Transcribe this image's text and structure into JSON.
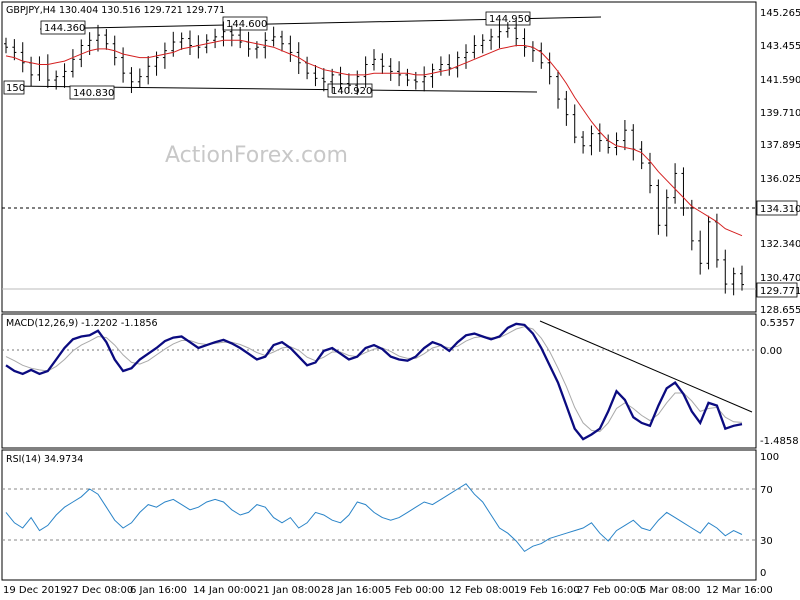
{
  "chart_data": [
    {
      "type": "candlestick",
      "header": "GBPJPY,H4  130.404 130.516 129.721 129.771",
      "watermark": "ActionForex.com",
      "ylim": [
        128.3,
        146.0
      ],
      "y_ticks": [
        "145.265",
        "143.455",
        "141.590",
        "139.710",
        "137.895",
        "136.025",
        "134.310",
        "132.340",
        "130.470",
        "129.771",
        "128.655"
      ],
      "price_labels": {
        "resistance": "134.310",
        "current": "129.771"
      },
      "annotations": [
        "144.360",
        "144.600",
        "144.950",
        "140.830",
        "140.920",
        "150"
      ],
      "x_labels": [
        "19 Dec 2019",
        "27 Dec 08:00",
        "6 Jan 16:00",
        "14 Jan 00:00",
        "21 Jan 08:00",
        "28 Jan 16:00",
        "5 Feb 00:00",
        "12 Feb 08:00",
        "19 Feb 16:00",
        "27 Feb 00:00",
        "5 Mar 08:00",
        "12 Mar 16:00"
      ],
      "closes": [
        143.5,
        143.2,
        142.6,
        141.9,
        142.5,
        141.6,
        141.8,
        142.1,
        142.8,
        143.6,
        143.9,
        144.2,
        143.7,
        142.9,
        142.0,
        141.5,
        141.8,
        142.4,
        142.9,
        143.3,
        143.8,
        144.0,
        143.6,
        143.5,
        143.9,
        144.1,
        144.4,
        144.2,
        143.8,
        143.4,
        143.5,
        143.9,
        144.1,
        143.7,
        143.2,
        142.6,
        142.0,
        141.7,
        141.5,
        141.9,
        141.4,
        141.3,
        141.8,
        142.5,
        142.8,
        142.4,
        142.1,
        141.9,
        141.6,
        141.5,
        141.8,
        142.2,
        142.5,
        142.3,
        142.9,
        143.2,
        143.6,
        143.9,
        144.1,
        144.4,
        144.6,
        144.0,
        143.5,
        143.3,
        142.6,
        141.8,
        140.5,
        139.6,
        138.3,
        137.8,
        138.5,
        138.1,
        137.7,
        138.1,
        138.7,
        137.6,
        136.8,
        135.5,
        133.2,
        134.8,
        136.2,
        134.2,
        132.3,
        131.0,
        133.4,
        131.2,
        129.8,
        130.4,
        129.77
      ],
      "ma": [
        143.0,
        142.9,
        142.7,
        142.6,
        142.5,
        142.5,
        142.6,
        142.7,
        142.9,
        143.1,
        143.3,
        143.4,
        143.4,
        143.3,
        143.1,
        143.0,
        142.9,
        142.9,
        143.0,
        143.1,
        143.2,
        143.4,
        143.5,
        143.6,
        143.7,
        143.8,
        143.9,
        143.9,
        143.9,
        143.8,
        143.7,
        143.6,
        143.5,
        143.3,
        143.1,
        142.9,
        142.6,
        142.4,
        142.2,
        142.1,
        142.0,
        141.9,
        141.9,
        141.9,
        142.0,
        142.0,
        142.0,
        142.0,
        142.0,
        141.9,
        141.9,
        142.0,
        142.1,
        142.2,
        142.4,
        142.6,
        142.8,
        143.0,
        143.2,
        143.4,
        143.5,
        143.6,
        143.6,
        143.5,
        143.2,
        142.7,
        142.1,
        141.4,
        140.6,
        139.9,
        139.2,
        138.6,
        138.1,
        137.8,
        137.7,
        137.6,
        137.4,
        136.9,
        136.3,
        135.8,
        135.3,
        134.8,
        134.3,
        134.0,
        133.7,
        133.4,
        133.0,
        132.8,
        132.6
      ]
    },
    {
      "type": "line",
      "title": "MACD(12,26,9) -1.2202 -1.1856",
      "ylim": [
        -1.6,
        0.62
      ],
      "y_ticks": [
        "0.5357",
        "0.00",
        "-1.4858"
      ],
      "series": [
        {
          "values": [
            -0.2,
            -0.3,
            -0.35,
            -0.28,
            -0.35,
            -0.3,
            -0.1,
            0.1,
            0.25,
            0.3,
            0.32,
            0.4,
            0.2,
            -0.1,
            -0.3,
            -0.25,
            -0.1,
            0.0,
            0.1,
            0.22,
            0.28,
            0.3,
            0.2,
            0.1,
            0.15,
            0.2,
            0.24,
            0.18,
            0.1,
            0.0,
            -0.1,
            -0.05,
            0.15,
            0.2,
            0.1,
            -0.05,
            -0.2,
            -0.15,
            0.05,
            0.1,
            0.0,
            -0.1,
            -0.05,
            0.1,
            0.15,
            0.08,
            -0.05,
            -0.1,
            -0.12,
            -0.05,
            0.1,
            0.2,
            0.15,
            0.05,
            0.2,
            0.32,
            0.35,
            0.3,
            0.25,
            0.3,
            0.45,
            0.52,
            0.5,
            0.35,
            0.1,
            -0.2,
            -0.5,
            -0.9,
            -1.3,
            -1.48,
            -1.4,
            -1.3,
            -1.0,
            -0.65,
            -0.8,
            -1.1,
            -1.2,
            -1.25,
            -0.9,
            -0.6,
            -0.5,
            -0.7,
            -1.0,
            -1.2,
            -0.85,
            -0.9,
            -1.3,
            -1.25,
            -1.22
          ]
        },
        {
          "values": [
            -0.05,
            -0.12,
            -0.2,
            -0.25,
            -0.28,
            -0.3,
            -0.22,
            -0.1,
            0.05,
            0.15,
            0.22,
            0.3,
            0.28,
            0.15,
            -0.02,
            -0.15,
            -0.18,
            -0.12,
            -0.02,
            0.08,
            0.17,
            0.23,
            0.23,
            0.18,
            0.16,
            0.18,
            0.2,
            0.2,
            0.16,
            0.1,
            0.02,
            -0.03,
            0.03,
            0.1,
            0.12,
            0.06,
            -0.06,
            -0.12,
            -0.06,
            0.03,
            0.03,
            -0.03,
            -0.05,
            0.02,
            0.08,
            0.1,
            0.04,
            -0.04,
            -0.08,
            -0.08,
            0.0,
            0.1,
            0.14,
            0.1,
            0.13,
            0.22,
            0.28,
            0.3,
            0.28,
            0.28,
            0.35,
            0.43,
            0.47,
            0.43,
            0.27,
            0.04,
            -0.25,
            -0.57,
            -0.93,
            -1.2,
            -1.33,
            -1.35,
            -1.2,
            -0.95,
            -0.85,
            -0.95,
            -1.07,
            -1.16,
            -1.05,
            -0.85,
            -0.68,
            -0.68,
            -0.82,
            -1.0,
            -0.95,
            -0.93,
            -1.1,
            -1.18,
            -1.19
          ]
        }
      ],
      "trendline": true
    },
    {
      "type": "line",
      "title": "RSI(14) 34.9734",
      "ylim": [
        0,
        100
      ],
      "y_ticks": [
        "100",
        "70",
        "30",
        "0"
      ],
      "levels": [
        70,
        30
      ],
      "series": [
        {
          "values": [
            52,
            44,
            40,
            48,
            38,
            42,
            50,
            56,
            60,
            64,
            70,
            66,
            56,
            46,
            40,
            44,
            52,
            58,
            56,
            60,
            62,
            58,
            54,
            56,
            60,
            62,
            60,
            54,
            50,
            52,
            58,
            56,
            48,
            44,
            48,
            40,
            44,
            52,
            50,
            46,
            44,
            50,
            60,
            58,
            52,
            48,
            46,
            48,
            52,
            56,
            60,
            58,
            62,
            66,
            70,
            74,
            66,
            60,
            50,
            40,
            36,
            30,
            22,
            26,
            28,
            32,
            34,
            36,
            38,
            40,
            44,
            36,
            30,
            38,
            42,
            46,
            40,
            38,
            46,
            52,
            48,
            44,
            40,
            36,
            44,
            40,
            34,
            38,
            35
          ]
        }
      ]
    }
  ]
}
